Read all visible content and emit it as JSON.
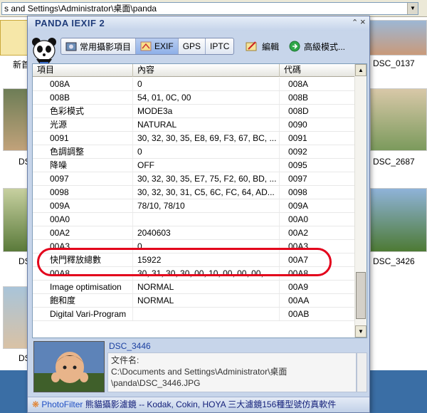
{
  "address_bar": {
    "path": "s and Settings\\Administrator\\桌面\\panda"
  },
  "explorer": {
    "labels": [
      "新首",
      "DSC_0137",
      "DSC_2687",
      "DSC_3426",
      "DS",
      "DS",
      "DS"
    ]
  },
  "window": {
    "title": "PANDA IEXIF 2",
    "title_buttons": [
      "⌃",
      "×"
    ]
  },
  "toolbar": {
    "tabs": [
      {
        "label": "常用攝影項目",
        "icon": "camera-info-icon"
      },
      {
        "label": "EXIF",
        "icon": "exif-icon",
        "active": true
      },
      {
        "label": "GPS"
      },
      {
        "label": "IPTC"
      }
    ],
    "edit_label": "編輯",
    "advanced_label": "高級模式..."
  },
  "table": {
    "headers": [
      "項目",
      "內容",
      "代碼"
    ],
    "rows": [
      [
        "008A",
        "0",
        "008A"
      ],
      [
        "008B",
        "54, 01, 0C, 00",
        "008B"
      ],
      [
        "色彩模式",
        "MODE3a",
        "008D"
      ],
      [
        "光源",
        "NATURAL",
        "0090"
      ],
      [
        "0091",
        "30, 32, 30, 35, E8, 69, F3, 67, BC, ...",
        "0091"
      ],
      [
        "色調調整",
        "0",
        "0092"
      ],
      [
        "降噪",
        "OFF",
        "0095"
      ],
      [
        "0097",
        "30, 32, 30, 35, E7, 75, F2, 60, BD, ...",
        "0097"
      ],
      [
        "0098",
        "30, 32, 30, 31, C5, 6C, FC, 64, AD...",
        "0098"
      ],
      [
        "009A",
        "78/10, 78/10",
        "009A"
      ],
      [
        "00A0",
        "",
        "00A0"
      ],
      [
        "00A2",
        "2040603",
        "00A2"
      ],
      [
        "00A3",
        "0",
        "00A3"
      ],
      [
        "快門釋放總數",
        "15922",
        "00A7"
      ],
      [
        "00A8",
        "30, 31, 30, 30, 00, 10, 00, 00, 00, ...",
        "00A8"
      ],
      [
        "Image optimisation",
        "NORMAL",
        "00A9"
      ],
      [
        "飽和度",
        "NORMAL",
        "00AA"
      ],
      [
        "Digital Vari-Program",
        "",
        "00AB"
      ]
    ]
  },
  "preview": {
    "filename": "DSC_3446",
    "info_label": "文件名:",
    "info_path_1": "C:\\Documents and Settings\\Administrator\\桌面",
    "info_path_2": "\\panda\\DSC_3446.JPG"
  },
  "footer": {
    "brand": "PhotoFilter",
    "text": " 熊貓攝影濾鏡 -- Kodak, Cokin, HOYA 三大濾鏡156種型號仿真軟件"
  },
  "colors": {
    "highlight": "#e3001b",
    "active_tab": "#8eb0e8",
    "window_bg": "#c7d5ea"
  }
}
